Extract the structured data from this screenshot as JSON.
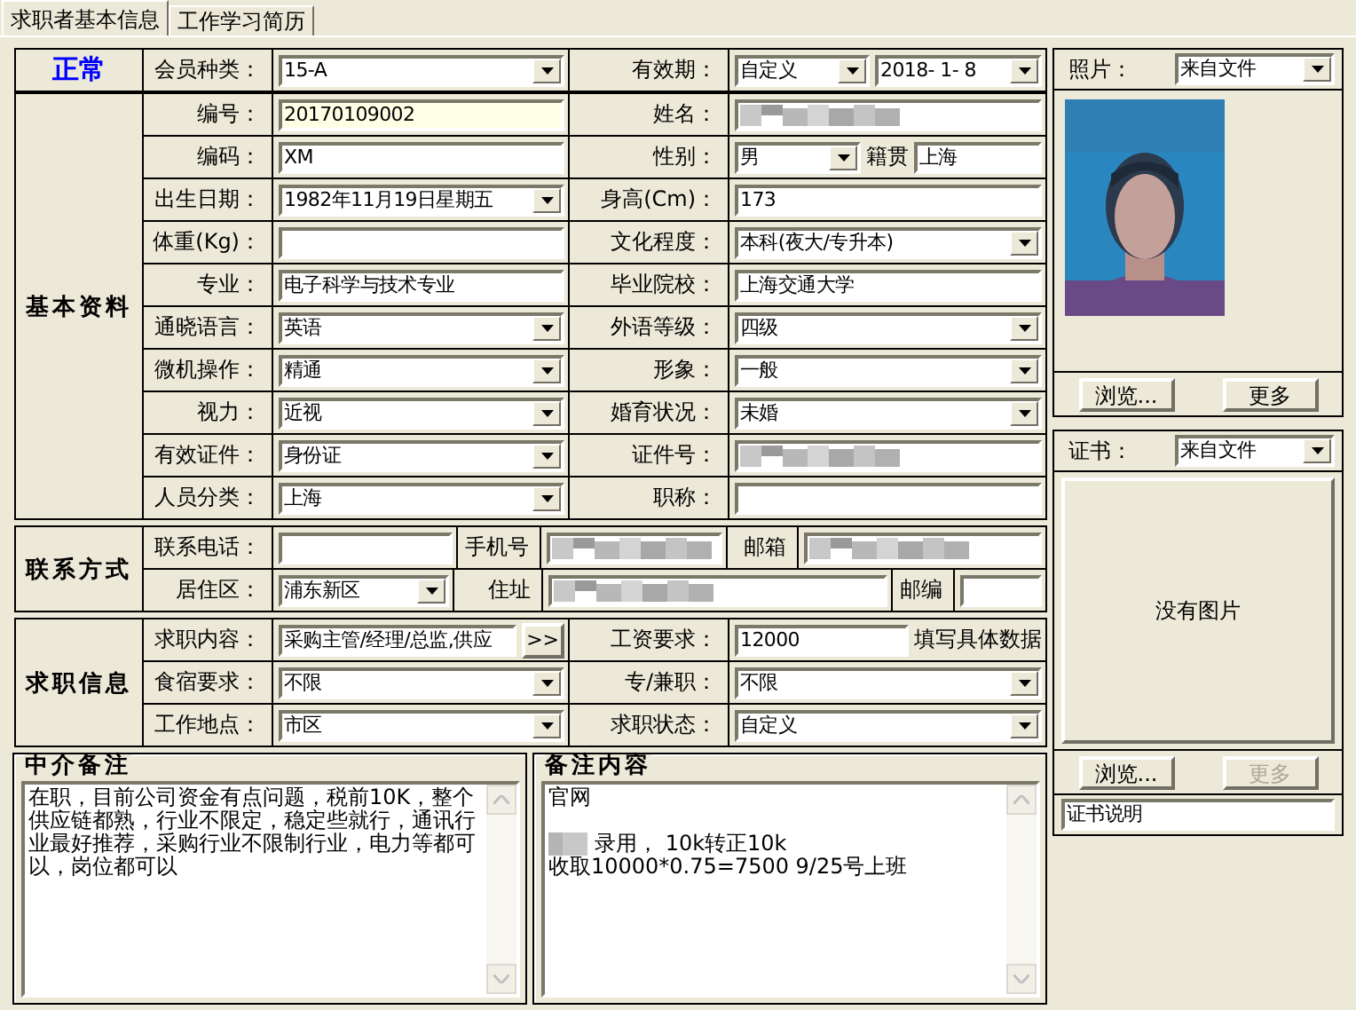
{
  "tabs": [
    {
      "label": "求职者基本信息",
      "selected": true
    },
    {
      "label": "工作学习简历",
      "selected": false
    }
  ],
  "status": "正常",
  "top_row": {
    "label": "会员种类：",
    "member_type": "15-A",
    "validity_label": "有效期：",
    "validity_mode": "自定义",
    "validity_date": "2018- 1- 8"
  },
  "sections": [
    {
      "title": "基本资料",
      "rows": [
        {
          "cells": [
            {
              "kind": "label",
              "text": "编号："
            },
            {
              "kind": "fields",
              "fields": [
                {
                  "kind": "readonly",
                  "value": "20170109002"
                }
              ]
            },
            {
              "kind": "label",
              "text": "姓名："
            },
            {
              "kind": "fields",
              "fields": [
                {
                  "kind": "redacted"
                }
              ]
            }
          ]
        },
        {
          "cells": [
            {
              "kind": "label",
              "text": "编码："
            },
            {
              "kind": "fields",
              "fields": [
                {
                  "kind": "text",
                  "value": "XM"
                }
              ]
            },
            {
              "kind": "label",
              "text": "性别："
            },
            {
              "kind": "fields",
              "fields": [
                {
                  "kind": "combo",
                  "value": "男"
                },
                {
                  "kind": "label",
                  "text": "籍贯"
                },
                {
                  "kind": "text",
                  "value": "上海"
                }
              ]
            }
          ]
        },
        {
          "cells": [
            {
              "kind": "label",
              "text": "出生日期："
            },
            {
              "kind": "fields",
              "fields": [
                {
                  "kind": "combo",
                  "value": "1982年11月19日星期五"
                }
              ]
            },
            {
              "kind": "label",
              "text": "身高(Cm)："
            },
            {
              "kind": "fields",
              "fields": [
                {
                  "kind": "text",
                  "value": "173"
                }
              ]
            }
          ]
        },
        {
          "cells": [
            {
              "kind": "label",
              "text": "体重(Kg)："
            },
            {
              "kind": "fields",
              "fields": [
                {
                  "kind": "text"
                }
              ]
            },
            {
              "kind": "label",
              "text": "文化程度："
            },
            {
              "kind": "fields",
              "fields": [
                {
                  "kind": "combo",
                  "value": "本科(夜大/专升本)"
                }
              ]
            }
          ]
        },
        {
          "cells": [
            {
              "kind": "label",
              "text": "专业："
            },
            {
              "kind": "fields",
              "fields": [
                {
                  "kind": "text",
                  "value": "电子科学与技术专业"
                }
              ]
            },
            {
              "kind": "label",
              "text": "毕业院校："
            },
            {
              "kind": "fields",
              "fields": [
                {
                  "kind": "text",
                  "value": "上海交通大学"
                }
              ]
            }
          ]
        },
        {
          "cells": [
            {
              "kind": "label",
              "text": "通晓语言："
            },
            {
              "kind": "fields",
              "fields": [
                {
                  "kind": "combo",
                  "value": "英语"
                }
              ]
            },
            {
              "kind": "label",
              "text": "外语等级："
            },
            {
              "kind": "fields",
              "fields": [
                {
                  "kind": "combo",
                  "value": "四级"
                }
              ]
            }
          ]
        },
        {
          "cells": [
            {
              "kind": "label",
              "text": "微机操作："
            },
            {
              "kind": "fields",
              "fields": [
                {
                  "kind": "combo",
                  "value": "精通"
                }
              ]
            },
            {
              "kind": "label",
              "text": "形象："
            },
            {
              "kind": "fields",
              "fields": [
                {
                  "kind": "combo",
                  "value": "一般"
                }
              ]
            }
          ]
        },
        {
          "cells": [
            {
              "kind": "label",
              "text": "视力："
            },
            {
              "kind": "fields",
              "fields": [
                {
                  "kind": "combo",
                  "value": "近视"
                }
              ]
            },
            {
              "kind": "label",
              "text": "婚育状况："
            },
            {
              "kind": "fields",
              "fields": [
                {
                  "kind": "combo",
                  "value": "未婚"
                }
              ]
            }
          ]
        },
        {
          "cells": [
            {
              "kind": "label",
              "text": "有效证件："
            },
            {
              "kind": "fields",
              "fields": [
                {
                  "kind": "combo",
                  "value": "身份证"
                }
              ]
            },
            {
              "kind": "label",
              "text": "证件号："
            },
            {
              "kind": "fields",
              "fields": [
                {
                  "kind": "redacted"
                }
              ]
            }
          ]
        },
        {
          "cells": [
            {
              "kind": "label",
              "text": "人员分类："
            },
            {
              "kind": "fields",
              "fields": [
                {
                  "kind": "combo",
                  "value": "上海"
                }
              ]
            },
            {
              "kind": "label",
              "text": "职称："
            },
            {
              "kind": "fields",
              "fields": [
                {
                  "kind": "text"
                }
              ]
            }
          ]
        }
      ]
    },
    {
      "title": "联系方式",
      "rows": [
        {
          "cells": [
            {
              "kind": "label",
              "text": "联系电话："
            },
            {
              "kind": "fields",
              "fields": [
                {
                  "kind": "text"
                }
              ]
            },
            {
              "kind": "label",
              "text": "手机号"
            },
            {
              "kind": "fields",
              "fields": [
                {
                  "kind": "redacted"
                }
              ]
            },
            {
              "kind": "label",
              "text": "邮箱"
            },
            {
              "kind": "fields",
              "fields": [
                {
                  "kind": "redacted"
                }
              ]
            }
          ]
        },
        {
          "cells": [
            {
              "kind": "label",
              "text": "居住区："
            },
            {
              "kind": "fields",
              "fields": [
                {
                  "kind": "combo",
                  "value": "浦东新区"
                }
              ]
            },
            {
              "kind": "label",
              "text": "住址"
            },
            {
              "kind": "fields",
              "fields": [
                {
                  "kind": "redacted"
                }
              ]
            },
            {
              "kind": "label",
              "text": "邮编"
            },
            {
              "kind": "fields",
              "fields": [
                {
                  "kind": "text"
                }
              ]
            }
          ]
        }
      ]
    },
    {
      "title": "求职信息",
      "rows": [
        {
          "cells": [
            {
              "kind": "label",
              "text": "求职内容："
            },
            {
              "kind": "fields",
              "fields": [
                {
                  "kind": "text",
                  "value": "采购主管/经理/总监,供应"
                },
                {
                  "kind": "button",
                  "value": ">>"
                }
              ]
            },
            {
              "kind": "label",
              "text": "工资要求："
            },
            {
              "kind": "fields",
              "fields": [
                {
                  "kind": "text",
                  "value": "12000"
                },
                {
                  "kind": "note",
                  "text": "填写具体数据"
                }
              ]
            }
          ]
        },
        {
          "cells": [
            {
              "kind": "label",
              "text": "食宿要求："
            },
            {
              "kind": "fields",
              "fields": [
                {
                  "kind": "combo",
                  "value": "不限"
                }
              ]
            },
            {
              "kind": "label",
              "text": "专/兼职："
            },
            {
              "kind": "fields",
              "fields": [
                {
                  "kind": "combo",
                  "value": "不限"
                }
              ]
            }
          ]
        },
        {
          "cells": [
            {
              "kind": "label",
              "text": "工作地点："
            },
            {
              "kind": "fields",
              "fields": [
                {
                  "kind": "combo",
                  "value": "市区"
                }
              ]
            },
            {
              "kind": "label",
              "text": "求职状态："
            },
            {
              "kind": "fields",
              "fields": [
                {
                  "kind": "combo",
                  "value": "自定义"
                }
              ]
            }
          ]
        }
      ]
    }
  ],
  "notes": [
    {
      "title": "中介备注",
      "lines": [
        {
          "kind": "text",
          "text": "在职，目前公司资金有点问题，税前10K，整个供应链都熟，行业不限定，稳定些就行，通讯行业最好推荐，采购行业不限制行业，电力等都可以，岗位都可以"
        }
      ]
    },
    {
      "title": "备注内容",
      "lines": [
        {
          "kind": "text",
          "text": "官网"
        },
        {
          "kind": "blank"
        },
        {
          "kind": "redacted_text",
          "text": "录用， 10k转正10k"
        },
        {
          "kind": "text",
          "text": "收取10000*0.75=7500 9/25号上班"
        }
      ]
    }
  ],
  "photo_panel": {
    "label": "照片：",
    "source": "来自文件",
    "kind": "picture",
    "buttons": [
      {
        "label": "浏览...",
        "disabled": false
      },
      {
        "label": "更多",
        "disabled": false
      }
    ]
  },
  "cert_panel": {
    "label": "证书：",
    "source": "来自文件",
    "empty_text": "没有图片",
    "buttons": [
      {
        "label": "浏览...",
        "disabled": false
      },
      {
        "label": "更多",
        "disabled": true
      }
    ],
    "caption": "证书说明"
  }
}
